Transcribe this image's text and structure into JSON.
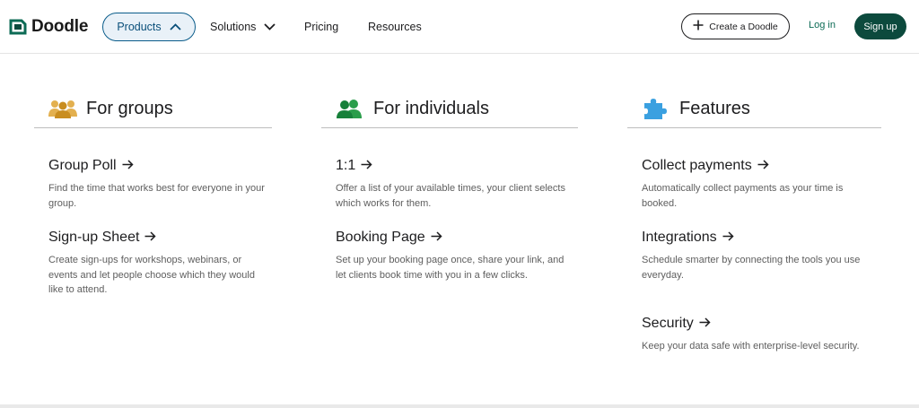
{
  "brand": {
    "name": "Doodle"
  },
  "nav": {
    "products": "Products",
    "solutions": "Solutions",
    "pricing": "Pricing",
    "resources": "Resources"
  },
  "actions": {
    "create": "Create a Doodle",
    "login": "Log in",
    "signup": "Sign up"
  },
  "columns": {
    "groups": {
      "title": "For groups",
      "icon": "group-people-icon",
      "items": [
        {
          "title": "Group Poll",
          "desc": "Find the time that works best for everyone in your group."
        },
        {
          "title": "Sign-up Sheet",
          "desc": "Create sign-ups for workshops, webinars, or events and let people choose which they would like to attend."
        }
      ]
    },
    "individuals": {
      "title": "For individuals",
      "icon": "individuals-icon",
      "items": [
        {
          "title": "1:1",
          "desc": "Offer a list of your available times, your client selects which works for them."
        },
        {
          "title": "Booking Page",
          "desc": "Set up your booking page once, share your link, and let clients book time with you in a few clicks."
        }
      ]
    },
    "features": {
      "title": "Features",
      "icon": "puzzle-piece-icon",
      "items": [
        {
          "title": "Collect payments",
          "desc": "Automatically collect payments as your time is booked."
        },
        {
          "title": "Integrations",
          "desc": "Schedule smarter by connecting the tools you use everyday."
        },
        {
          "title": "Security",
          "desc": "Keep your data safe with enterprise-level security."
        }
      ]
    }
  },
  "colors": {
    "accent_blue": "#0a5c8a",
    "signup_green": "#0c4a3d",
    "login_green": "#0c6b55",
    "groups_icon": "#d9a23b",
    "individuals_icon": "#1e8a3c",
    "features_icon": "#3aa0e0"
  }
}
